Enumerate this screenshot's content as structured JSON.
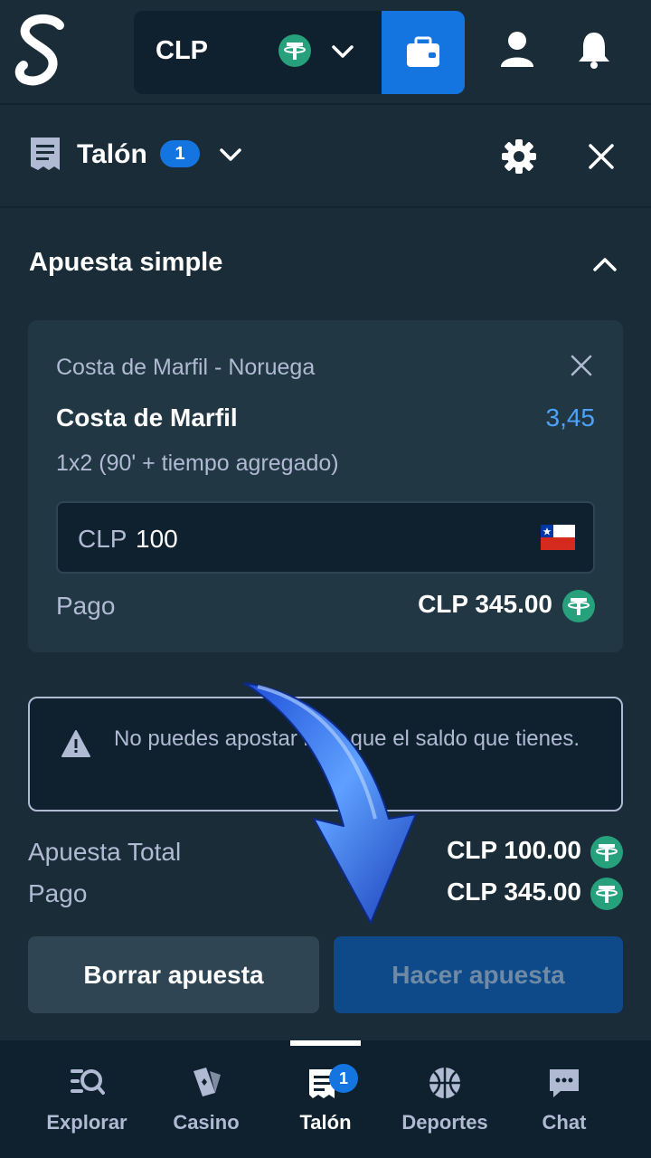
{
  "header": {
    "currency": "CLP",
    "icons": [
      "stake-logo",
      "tether-coin-icon",
      "chevron-down-icon",
      "wallet-icon",
      "user-icon",
      "bell-icon"
    ]
  },
  "betslip": {
    "title": "Talón",
    "count": "1",
    "section_title": "Apuesta simple",
    "bet": {
      "match": "Costa de Marfil - Noruega",
      "selection": "Costa de Marfil",
      "odds": "3,45",
      "market": "1x2 (90' + tiempo agregado)",
      "stake_currency": "CLP",
      "stake_value": "100",
      "payout_label": "Pago",
      "payout_value": "CLP 345.00"
    },
    "warning": "No puedes apostar más que el saldo que tienes.",
    "summary": {
      "total_label": "Apuesta Total",
      "total_value": "CLP 100.00",
      "payout_label": "Pago",
      "payout_value": "CLP 345.00"
    },
    "buttons": {
      "clear": "Borrar apuesta",
      "place": "Hacer apuesta"
    }
  },
  "nav": {
    "items": [
      {
        "label": "Explorar",
        "icon": "explore-icon"
      },
      {
        "label": "Casino",
        "icon": "casino-icon"
      },
      {
        "label": "Talón",
        "icon": "betslip-icon",
        "badge": "1"
      },
      {
        "label": "Deportes",
        "icon": "basketball-icon"
      },
      {
        "label": "Chat",
        "icon": "chat-icon"
      }
    ]
  },
  "colors": {
    "background": "#1a2c38",
    "panel": "#213743",
    "dark": "#0f212e",
    "accent": "#1475e1",
    "tether": "#26a17b",
    "odds": "#4aa3ff"
  }
}
